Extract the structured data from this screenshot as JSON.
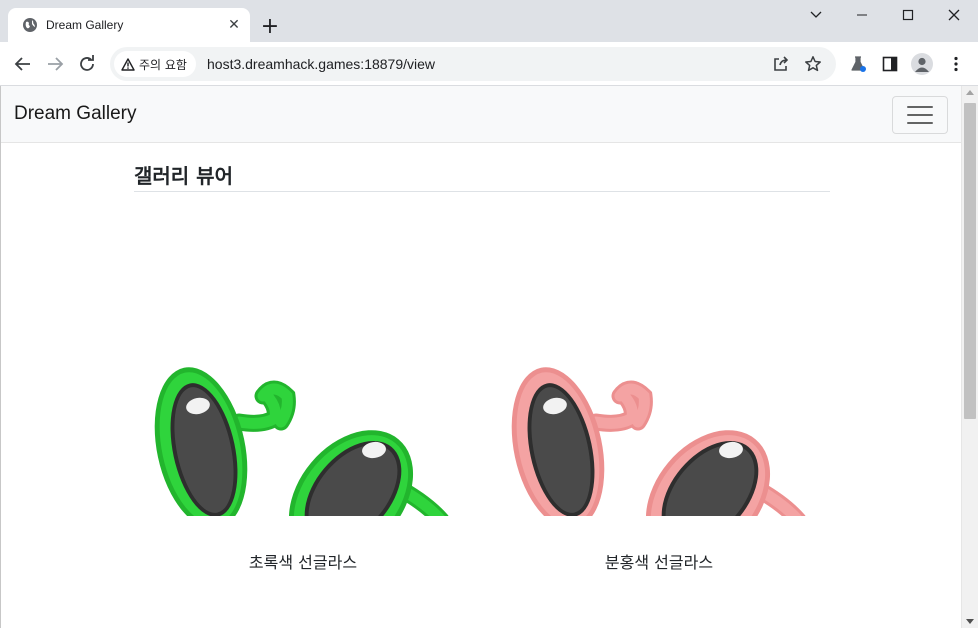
{
  "browser": {
    "tab_title": "Dream Gallery",
    "tab_close": "✕",
    "new_tab": "+",
    "security_label": "주의 요함",
    "url": "host3.dreamhack.games:18879/view"
  },
  "navbar": {
    "brand": "Dream Gallery"
  },
  "page": {
    "title": "갤러리 뷰어"
  },
  "gallery": {
    "items": [
      {
        "caption": "초록색 선글라스",
        "frame_color": "#2fd43c",
        "frame_edge": "#22b52d"
      },
      {
        "caption": "분홍색 선글라스",
        "frame_color": "#f4a3a3",
        "frame_edge": "#ec8f8f"
      }
    ],
    "lens_color": "#4a4a4a",
    "lens_edge": "#2e2e2e"
  }
}
